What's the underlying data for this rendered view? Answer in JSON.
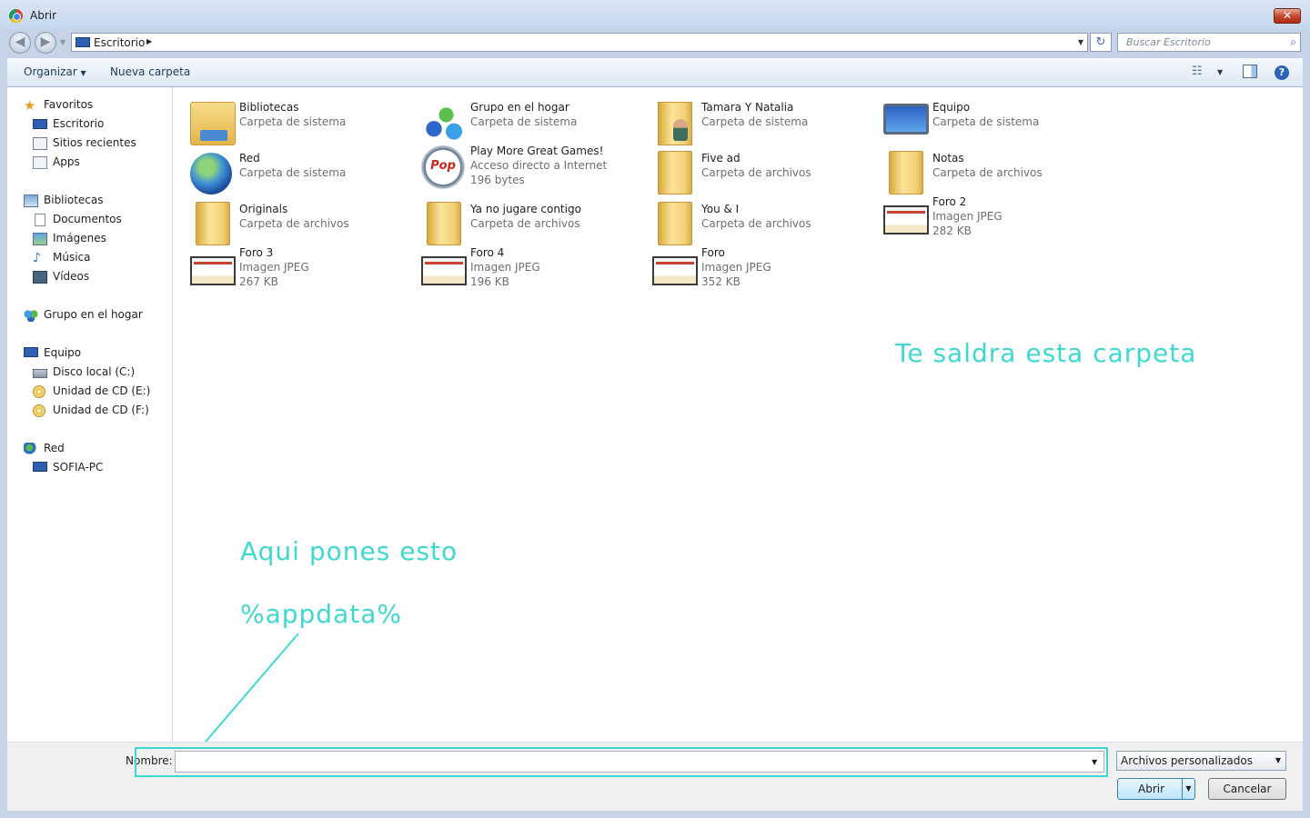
{
  "window": {
    "title": "Abrir",
    "close_glyph": "✕"
  },
  "nav": {
    "back_glyph": "◀",
    "forward_glyph": "▶",
    "address": "Escritorio",
    "search_placeholder": "Buscar Escritorio",
    "refresh_glyph": "↻",
    "search_glyph": "⌕"
  },
  "toolbar": {
    "organize": "Organizar",
    "new_folder": "Nueva carpeta",
    "help": "?"
  },
  "sidebar": {
    "items": [
      {
        "label": "Favoritos",
        "icon": "star-icon"
      },
      {
        "label": "Escritorio",
        "icon": "desktop-icon"
      },
      {
        "label": "Sitios recientes",
        "icon": "recent-places-icon"
      },
      {
        "label": "Apps",
        "icon": "folder-icon"
      },
      {
        "label": "Bibliotecas",
        "icon": "libraries-icon"
      },
      {
        "label": "Documentos",
        "icon": "documents-icon"
      },
      {
        "label": "Imágenes",
        "icon": "pictures-icon"
      },
      {
        "label": "Música",
        "icon": "music-icon"
      },
      {
        "label": "Vídeos",
        "icon": "videos-icon"
      },
      {
        "label": "Grupo en el hogar",
        "icon": "homegroup-icon"
      },
      {
        "label": "Equipo",
        "icon": "computer-icon"
      },
      {
        "label": "Disco local (C:)",
        "icon": "disk-icon"
      },
      {
        "label": "Unidad de CD (E:)",
        "icon": "cd-drive-icon"
      },
      {
        "label": "Unidad de CD (F:)",
        "icon": "cd-drive-icon"
      },
      {
        "label": "Red",
        "icon": "network-icon"
      },
      {
        "label": "SOFIA-PC",
        "icon": "pc-icon"
      }
    ]
  },
  "files": [
    {
      "name": "Bibliotecas",
      "type": "Carpeta de sistema",
      "size": "",
      "icon": "libraries-icon"
    },
    {
      "name": "Grupo en el hogar",
      "type": "Carpeta de sistema",
      "size": "",
      "icon": "homegroup-icon"
    },
    {
      "name": "Tamara Y Natalia",
      "type": "Carpeta de sistema",
      "size": "",
      "icon": "user-folder-icon"
    },
    {
      "name": "Equipo",
      "type": "Carpeta de sistema",
      "size": "",
      "icon": "computer-icon"
    },
    {
      "name": "Red",
      "type": "Carpeta de sistema",
      "size": "",
      "icon": "network-globe-icon"
    },
    {
      "name": "Play More Great Games!",
      "type": "Acceso directo a Internet",
      "size": "196 bytes",
      "icon": "popcap-icon",
      "icon_text": "Pop Cap"
    },
    {
      "name": "Five ad",
      "type": "Carpeta de archivos",
      "size": "",
      "icon": "folder-icon"
    },
    {
      "name": "Notas",
      "type": "Carpeta de archivos",
      "size": "",
      "icon": "folder-icon"
    },
    {
      "name": "Originals",
      "type": "Carpeta de archivos",
      "size": "",
      "icon": "folder-icon"
    },
    {
      "name": "Ya no jugare contigo",
      "type": "Carpeta de archivos",
      "size": "",
      "icon": "folder-icon"
    },
    {
      "name": "You & I",
      "type": "Carpeta de archivos",
      "size": "",
      "icon": "folder-icon"
    },
    {
      "name": "Foro 2",
      "type": "Imagen JPEG",
      "size": "282 KB",
      "icon": "image-thumbnail-icon"
    },
    {
      "name": "Foro 3",
      "type": "Imagen JPEG",
      "size": "267 KB",
      "icon": "image-thumbnail-icon"
    },
    {
      "name": "Foro 4",
      "type": "Imagen JPEG",
      "size": "196 KB",
      "icon": "image-thumbnail-icon"
    },
    {
      "name": "Foro",
      "type": "Imagen JPEG",
      "size": "352 KB",
      "icon": "image-thumbnail-icon"
    }
  ],
  "annotations": {
    "folder_note": "Te saldra esta carpeta",
    "instruction": "Aqui pones esto",
    "command": "%appdata%",
    "color": "#3fd8cf"
  },
  "footer": {
    "name_label": "Nombre:",
    "name_value": "",
    "filter": "Archivos personalizados",
    "open": "Abrir",
    "cancel": "Cancelar"
  }
}
